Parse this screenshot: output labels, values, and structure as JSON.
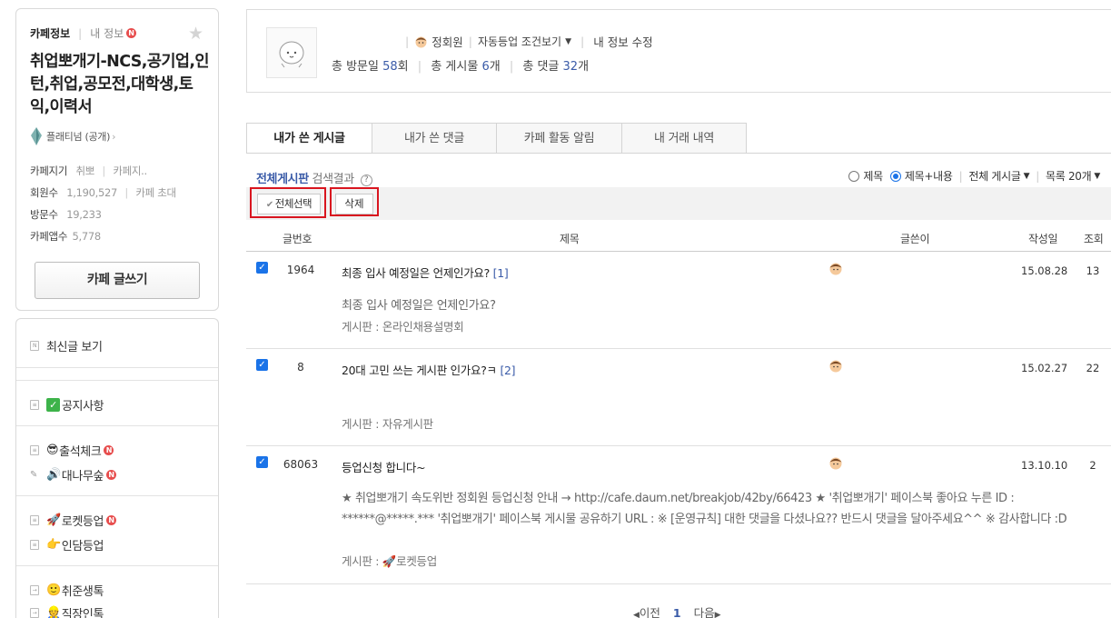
{
  "sidebar": {
    "tab_active": "카페정보",
    "tab_inactive": "내 정보",
    "new_badge": "N",
    "star_icon": "star-icon",
    "cafe_name": "취업뽀개기-NCS,공기업,인턴,취업,공모전,대학생,토익,이력서",
    "grade": "플래티넘 (공개)",
    "stats": {
      "manager_label": "카페지기",
      "manager_value": "취뽀",
      "manager_value2": "카페지..",
      "members_label": "회원수",
      "members_value": "1,190,527",
      "invite_label": "카페 초대",
      "visits_label": "방문수",
      "visits_value": "19,233",
      "app_label": "카페앱수",
      "app_value": "5,778"
    },
    "write_button": "카페 글쓰기",
    "menu": {
      "recent": "최신글 보기",
      "notice": "공지사항",
      "attendance": "출석체크",
      "bamboo": "대나무숲",
      "rocket": "로켓등업",
      "greeting": "인담등업",
      "life": "취준생톡",
      "work": "직장인톡"
    }
  },
  "profile": {
    "nickname": "정회원",
    "auto_level": "자동등업 조건보기",
    "edit": "내 정보 수정",
    "visit_label": "총 방문일",
    "visit_count": "58",
    "visit_unit": "회",
    "post_label": "총 게시물",
    "post_count": "6",
    "post_unit": "개",
    "comment_label": "총 댓글",
    "comment_count": "32",
    "comment_unit": "개"
  },
  "tabs": [
    "내가 쓴 게시글",
    "내가 쓴 댓글",
    "카페 활동 알림",
    "내 거래 내역"
  ],
  "filter": {
    "board_name": "전체게시판",
    "result_label": "검색결과",
    "help": "?",
    "radio_title": "제목",
    "radio_title_content": "제목+내용",
    "all_posts": "전체 게시글",
    "list_count": "목록 20개"
  },
  "actions": {
    "select_all": "전체선택",
    "delete": "삭제"
  },
  "table": {
    "headers": {
      "num": "글번호",
      "title": "제목",
      "author": "글쓴이",
      "date": "작성일",
      "views": "조회"
    },
    "rows": [
      {
        "num": "1964",
        "title": "최종 입사 예정일은 언제인가요?",
        "comments": "[1]",
        "preview": "최종 입사 예정일은 언제인가요?",
        "board": "게시판 : 온라인채용설명회",
        "date": "15.08.28",
        "views": "13"
      },
      {
        "num": "8",
        "title": "20대 고민 쓰는 게시판 인가요?ㅋ",
        "comments": "[2]",
        "preview": "",
        "board": "게시판 : 자유게시판",
        "date": "15.02.27",
        "views": "22"
      },
      {
        "num": "68063",
        "title": "등업신청 합니다~",
        "comments": "",
        "preview": "★ 취업뽀개기 속도위반 정회원 등업신청 안내 → http://cafe.daum.net/breakjob/42by/66423 ★ '취업뽀개기' 페이스북 좋아요 누른 ID : ******@*****.*** '취업뽀개기' 페이스북 게시물 공유하기 URL : ※ [운영규칙] 대한 댓글을 다셨나요?? 반드시 댓글을 달아주세요^^ ※ 감사합니다 :D",
        "board": "게시판 : 🚀로켓등업",
        "date": "13.10.10",
        "views": "2"
      }
    ]
  },
  "pager": {
    "prev": "이전",
    "current": "1",
    "next": "다음"
  },
  "colors": {
    "accent": "#3a5ba8",
    "highlight_box": "#d9151f",
    "checkbox": "#1a73e8"
  }
}
